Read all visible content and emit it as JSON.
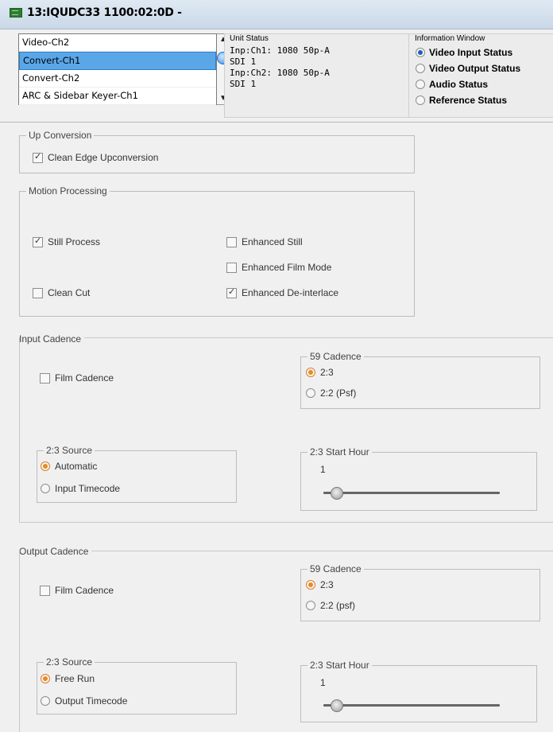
{
  "window": {
    "title": "13:IQUDC33  1100:02:0D  -"
  },
  "channel_list": {
    "items": [
      "Video-Ch2",
      "Convert-Ch1",
      "Convert-Ch2",
      "ARC & Sidebar Keyer-Ch1"
    ],
    "selected": "Convert-Ch1"
  },
  "unit_status": {
    "label": "Unit Status",
    "lines": [
      "Inp:Ch1: 1080 50p-A",
      "SDI 1",
      "Inp:Ch2: 1080 50p-A",
      "SDI 1"
    ]
  },
  "info_window": {
    "label": "Information Window",
    "options": [
      "Video Input Status",
      "Video Output Status",
      "Audio Status",
      "Reference Status"
    ],
    "selected": "Video Input Status"
  },
  "up_conversion": {
    "legend": "Up Conversion",
    "clean_edge": {
      "label": "Clean Edge Upconversion",
      "checked": true
    }
  },
  "motion_processing": {
    "legend": "Motion Processing",
    "still_process": {
      "label": "Still Process",
      "checked": true
    },
    "enhanced_still": {
      "label": "Enhanced Still",
      "checked": false
    },
    "enhanced_film_mode": {
      "label": "Enhanced Film Mode",
      "checked": false
    },
    "clean_cut": {
      "label": "Clean Cut",
      "checked": false
    },
    "enhanced_deinterlace": {
      "label": "Enhanced De-interlace",
      "checked": true
    }
  },
  "input_cadence": {
    "title": "Input Cadence",
    "film_cadence": {
      "label": "Film Cadence",
      "checked": false
    },
    "cadence59": {
      "legend": "59 Cadence",
      "options": [
        "2:3",
        "2:2 (Psf)"
      ],
      "selected": "2:3"
    },
    "source": {
      "legend": "2:3 Source",
      "options": [
        "Automatic",
        "Input Timecode"
      ],
      "selected": "Automatic"
    },
    "start_hour": {
      "legend": "2:3 Start Hour",
      "value": "1",
      "slider_fraction": 0.07
    }
  },
  "output_cadence": {
    "title": "Output Cadence",
    "film_cadence": {
      "label": "Film Cadence",
      "checked": false
    },
    "cadence59": {
      "legend": "59 Cadence",
      "options": [
        "2:3",
        "2:2 (psf)"
      ],
      "selected": "2:3"
    },
    "source": {
      "legend": "2:3 Source",
      "options": [
        "Free Run",
        "Output Timecode"
      ],
      "selected": "Free Run"
    },
    "start_hour": {
      "legend": "2:3 Start Hour",
      "value": "1",
      "slider_fraction": 0.07
    }
  },
  "colors": {
    "selection": "#5aa7e8",
    "radio_active": "#ec8a1d",
    "info_radio": "#1e5fb7"
  }
}
